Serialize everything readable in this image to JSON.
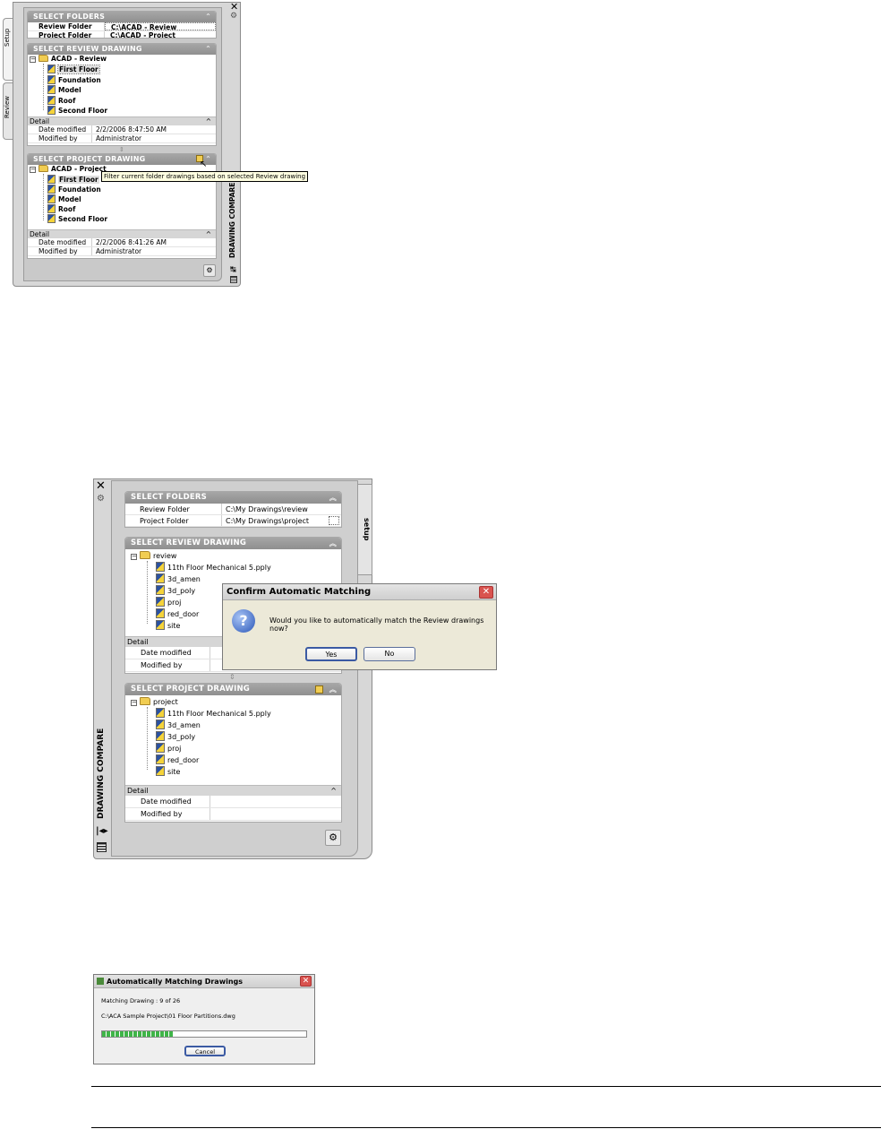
{
  "palette1": {
    "tabs": [
      "Setup",
      "Review"
    ],
    "vertical_title": "DRAWING COMPARE",
    "folders": {
      "header": "SELECT FOLDERS",
      "review_label": "Review Folder",
      "review_value": "C:\\ACAD - Review",
      "project_label": "Project Folder",
      "project_value": "C:\\ACAD - Project"
    },
    "review": {
      "header": "SELECT REVIEW DRAWING",
      "root": "ACAD - Review",
      "items": [
        "First Floor",
        "Foundation",
        "Model",
        "Roof",
        "Second Floor"
      ],
      "detail_label": "Detail",
      "date_label": "Date modified",
      "date_value": "2/2/2006 8:47:50 AM",
      "modby_label": "Modified by",
      "modby_value": "Administrator"
    },
    "project": {
      "header": "SELECT PROJECT DRAWING",
      "root": "ACAD - Project",
      "items": [
        "First Floor",
        "Foundation",
        "Model",
        "Roof",
        "Second Floor"
      ],
      "detail_label": "Detail",
      "date_label": "Date modified",
      "date_value": "2/2/2006 8:41:26 AM",
      "modby_label": "Modified by",
      "modby_value": "Administrator"
    },
    "tooltip": "Filter current folder drawings based on selected Review drawing"
  },
  "palette2": {
    "tab": "setup",
    "vertical_title": "DRAWING COMPARE",
    "folders": {
      "header": "SELECT FOLDERS",
      "review_label": "Review Folder",
      "review_value": "C:\\My Drawings\\review",
      "project_label": "Project Folder",
      "project_value": "C:\\My Drawings\\project"
    },
    "review": {
      "header": "SELECT REVIEW DRAWING",
      "root": "review",
      "items": [
        "11th Floor Mechanical 5.pply",
        "3d_amen",
        "3d_poly",
        "proj",
        "red_door",
        "site"
      ],
      "detail_label": "Detail",
      "date_label": "Date modified",
      "modby_label": "Modified by"
    },
    "project": {
      "header": "SELECT PROJECT DRAWING",
      "root": "project",
      "items": [
        "11th Floor Mechanical 5.pply",
        "3d_amen",
        "3d_poly",
        "proj",
        "red_door",
        "site"
      ],
      "detail_label": "Detail",
      "date_label": "Date modified",
      "modby_label": "Modified by"
    }
  },
  "confirm_dialog": {
    "title": "Confirm Automatic Matching",
    "message": "Would you like to automatically match the Review drawings now?",
    "yes": "Yes",
    "no": "No"
  },
  "progress_dialog": {
    "title": "Automatically Matching Drawings",
    "status": "Matching Drawing : 9 of 26",
    "path": "C:\\ACA Sample Project\\01 Floor Partitions.dwg",
    "progress_fraction": 0.35,
    "cancel": "Cancel"
  }
}
